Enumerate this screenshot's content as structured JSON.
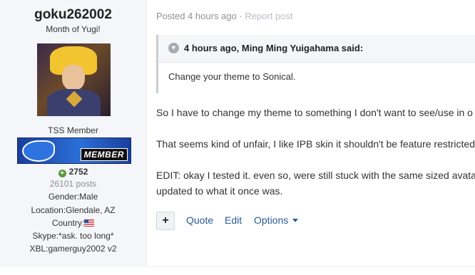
{
  "author": {
    "username": "goku262002",
    "title": "Month of Yugi!",
    "avatar_icon": "yugi-avatar-image",
    "group": "TSS Member",
    "badge_text": "MEMBER",
    "reputation": "2752",
    "posts": "26101 posts",
    "gender": "Gender:Male",
    "location": "Location:Glendale, AZ",
    "country": "Country:",
    "country_icon": "us-flag-icon",
    "skype": "Skype:*ask. too long*",
    "xbl": "XBL:gamerguy2002 v2"
  },
  "post": {
    "posted": "Posted 4 hours ago",
    "separator": " · ",
    "report": "Report post",
    "quote": {
      "header": "4 hours ago, Ming Ming Yuigahama said:",
      "body": "Change your theme to Sonical."
    },
    "paragraphs": [
      "So I have to change my theme to something I don't want to see/use in o",
      "That seems kind of unfair, I like IPB skin it shouldn't be feature restricted",
      "EDIT: okay I tested it. even so, were still stuck with the same sized avata",
      "updated to what it once was."
    ],
    "actions": {
      "plus": "+",
      "quote": "Quote",
      "edit": "Edit",
      "options": "Options"
    }
  },
  "colors": {
    "sidebar_bg": "#f4f6f9",
    "link": "#2a5a97",
    "muted": "#8d9399",
    "rep_green": "#5a9a3a"
  }
}
